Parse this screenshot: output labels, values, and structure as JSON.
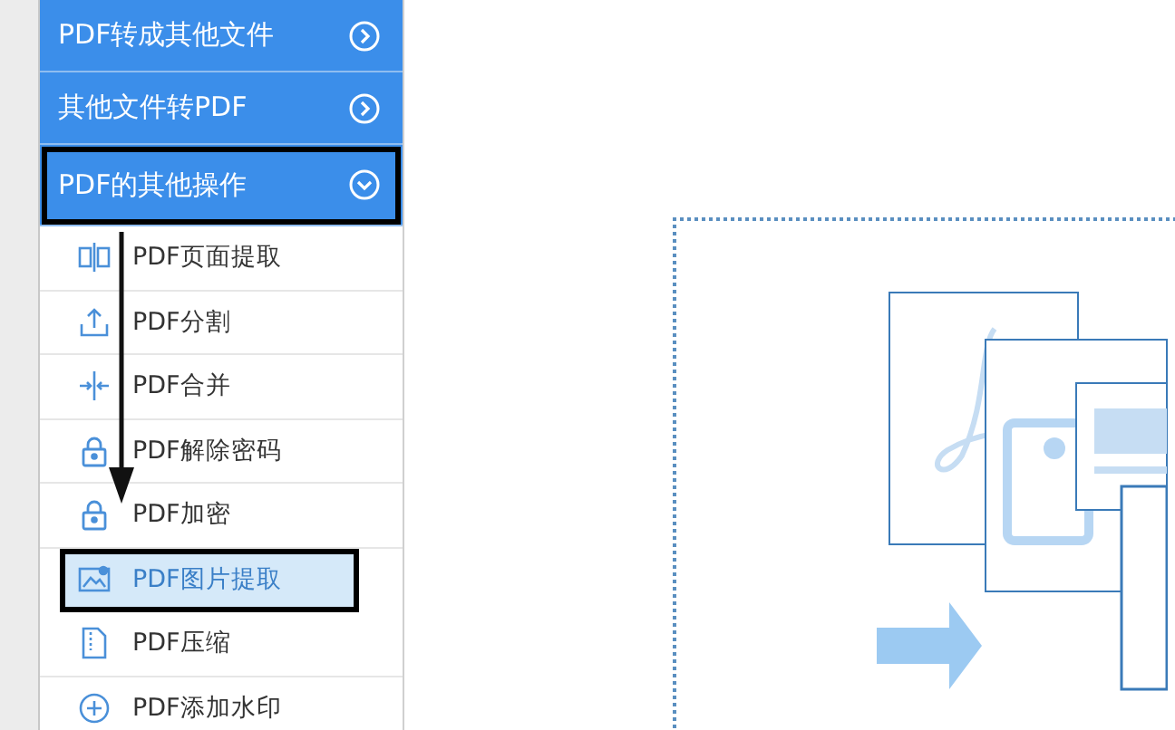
{
  "sidebar": {
    "sections": [
      {
        "label": "PDF转成其他文件",
        "expanded": false,
        "annotated": false
      },
      {
        "label": "其他文件转PDF",
        "expanded": false,
        "annotated": false
      },
      {
        "label": "PDF的其他操作",
        "expanded": true,
        "annotated": true
      }
    ],
    "items": [
      {
        "kind": "page",
        "label": "PDF页面提取",
        "selected": false,
        "annotated": false
      },
      {
        "kind": "split",
        "label": "PDF分割",
        "selected": false,
        "annotated": false
      },
      {
        "kind": "merge",
        "label": "PDF合并",
        "selected": false,
        "annotated": false
      },
      {
        "kind": "unlock",
        "label": "PDF解除密码",
        "selected": false,
        "annotated": false
      },
      {
        "kind": "lock",
        "label": "PDF加密",
        "selected": false,
        "annotated": false
      },
      {
        "kind": "image",
        "label": "PDF图片提取",
        "selected": true,
        "annotated": true
      },
      {
        "kind": "compress",
        "label": "PDF压缩",
        "selected": false,
        "annotated": false
      },
      {
        "kind": "watermark",
        "label": "PDF添加水印",
        "selected": false,
        "annotated": false
      }
    ]
  }
}
